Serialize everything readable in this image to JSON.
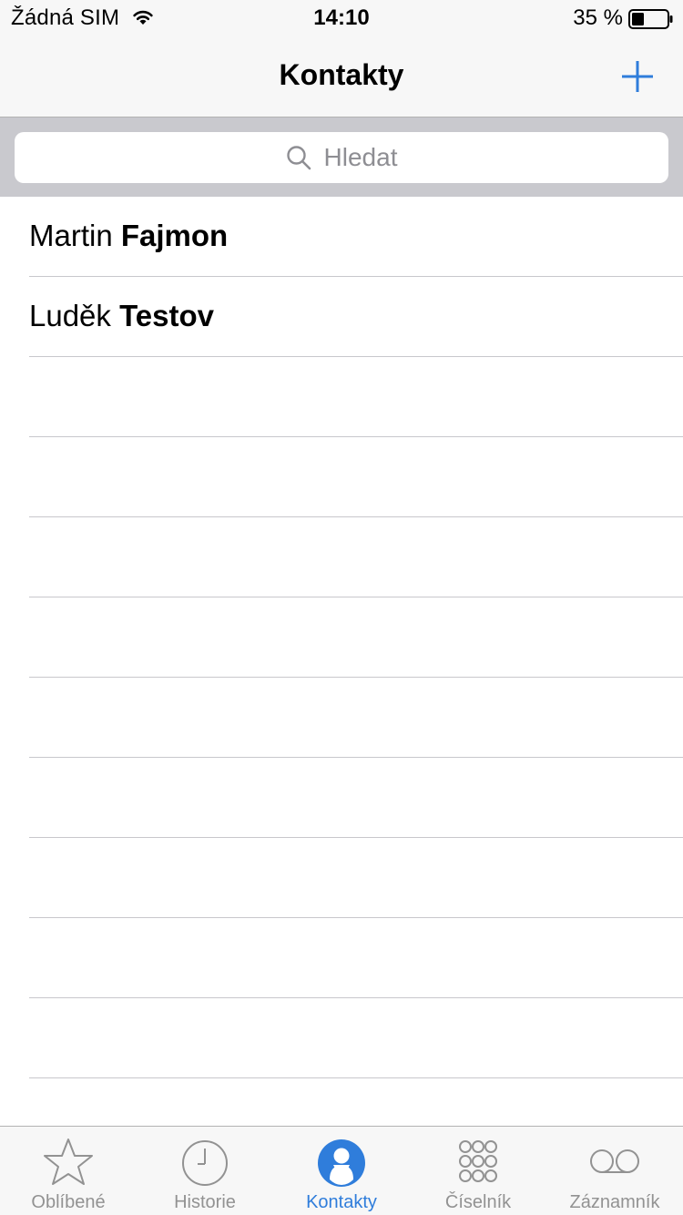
{
  "status_bar": {
    "carrier": "Žádná SIM",
    "time": "14:10",
    "battery_percent": "35 %",
    "wifi_icon": "wifi-icon",
    "battery_icon": "battery-icon"
  },
  "nav": {
    "title": "Kontakty",
    "add_icon": "plus-icon",
    "accent": "#2f7ddb"
  },
  "search": {
    "placeholder": "Hledat",
    "icon": "search-icon"
  },
  "contacts": [
    {
      "first": "Martin",
      "last": "Fajmon"
    },
    {
      "first": "Luděk",
      "last": "Testov"
    }
  ],
  "tabs": [
    {
      "label": "Oblíbené",
      "icon": "star-icon",
      "active": false
    },
    {
      "label": "Historie",
      "icon": "clock-icon",
      "active": false
    },
    {
      "label": "Kontakty",
      "icon": "contact-icon",
      "active": true
    },
    {
      "label": "Číselník",
      "icon": "keypad-icon",
      "active": false
    },
    {
      "label": "Záznamník",
      "icon": "voicemail-icon",
      "active": false
    }
  ]
}
